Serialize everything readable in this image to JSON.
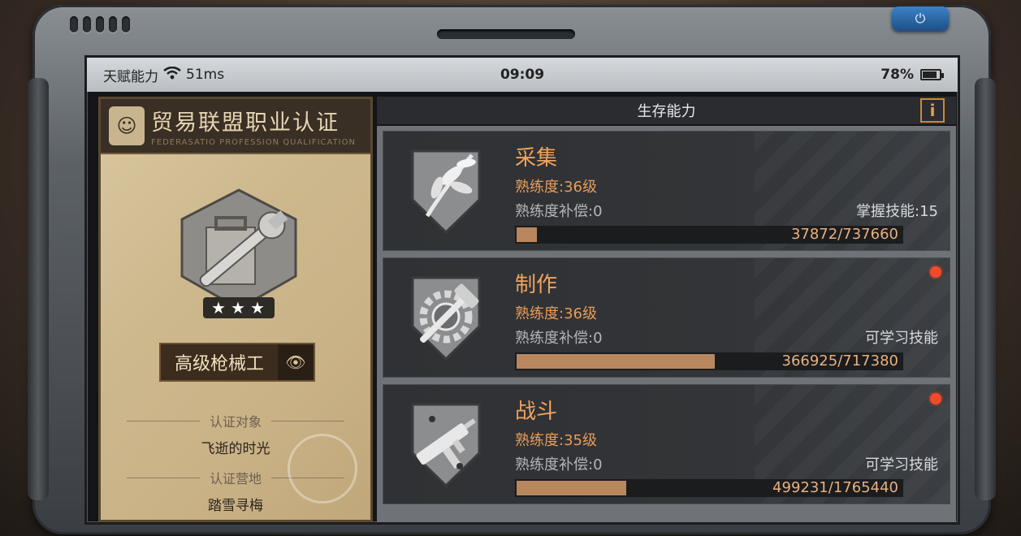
{
  "status_bar": {
    "label": "天赋能力",
    "ping": "51ms",
    "time": "09:09",
    "battery": "78%",
    "battery_level": 0.78
  },
  "certificate": {
    "title": "贸易联盟职业认证",
    "subtitle": "FEDERASATIO PROFESSION QUALIFICATION",
    "rank": "高级枪械工",
    "stars": 3,
    "target_label": "认证对象",
    "target_value": "飞逝的时光",
    "camp_label": "认证营地",
    "camp_value": "踏雪寻梅"
  },
  "panel": {
    "title": "生存能力",
    "info_label": "i"
  },
  "skills": [
    {
      "name": "采集",
      "icon": "leaves-shield-icon",
      "level": "熟练度:36级",
      "compensation": "熟练度补偿:0",
      "right_text": "掌握技能:15",
      "progress_text": "37872/737660",
      "progress": 0.0513,
      "has_alert": false
    },
    {
      "name": "制作",
      "icon": "gear-hammer-icon",
      "level": "熟练度:36级",
      "compensation": "熟练度补偿:0",
      "right_text": "可学习技能",
      "progress_text": "366925/717380",
      "progress": 0.5115,
      "has_alert": true
    },
    {
      "name": "战斗",
      "icon": "smg-icon",
      "level": "熟练度:35级",
      "compensation": "熟练度补偿:0",
      "right_text": "可学习技能",
      "progress_text": "499231/1765440",
      "progress": 0.2828,
      "has_alert": true
    }
  ],
  "colors": {
    "accent_orange": "#f1a35c",
    "progress_fill": "#b9875e",
    "alert_red": "#f04a2a"
  }
}
